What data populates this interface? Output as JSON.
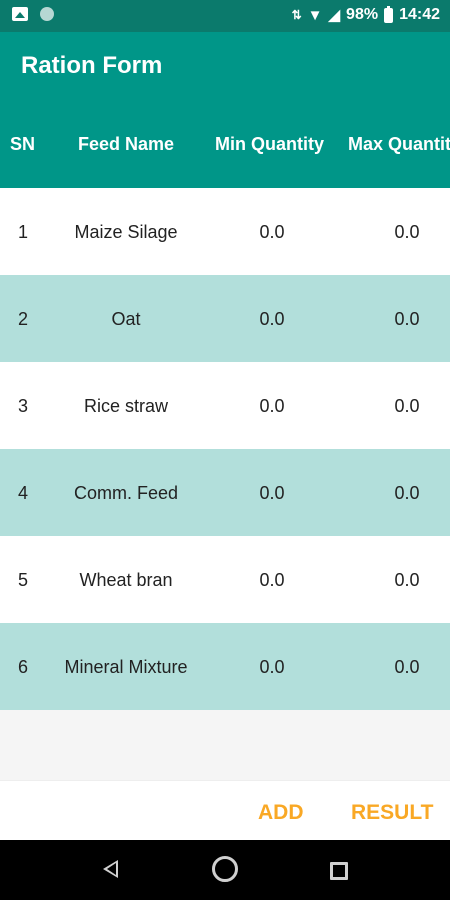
{
  "status_bar": {
    "battery": "98%",
    "time": "14:42"
  },
  "app_bar": {
    "title": "Ration Form"
  },
  "table": {
    "headers": {
      "sn": "SN",
      "feed_name": "Feed Name",
      "min_qty": "Min Quantity",
      "max_qty": "Max Quantity"
    },
    "rows": [
      {
        "sn": "1",
        "feed_name": "Maize Silage",
        "min": "0.0",
        "max": "0.0"
      },
      {
        "sn": "2",
        "feed_name": "Oat",
        "min": "0.0",
        "max": "0.0"
      },
      {
        "sn": "3",
        "feed_name": "Rice straw",
        "min": "0.0",
        "max": "0.0"
      },
      {
        "sn": "4",
        "feed_name": "Comm. Feed",
        "min": "0.0",
        "max": "0.0"
      },
      {
        "sn": "5",
        "feed_name": "Wheat bran",
        "min": "0.0",
        "max": "0.0"
      },
      {
        "sn": "6",
        "feed_name": "Mineral Mixture",
        "min": "0.0",
        "max": "0.0"
      }
    ]
  },
  "footer": {
    "add_label": "ADD",
    "result_label": "RESULT"
  },
  "colors": {
    "primary": "#009688",
    "primary_dark": "#0b7a6c",
    "row_alt": "#b2dfdb",
    "accent": "#f9a825"
  }
}
